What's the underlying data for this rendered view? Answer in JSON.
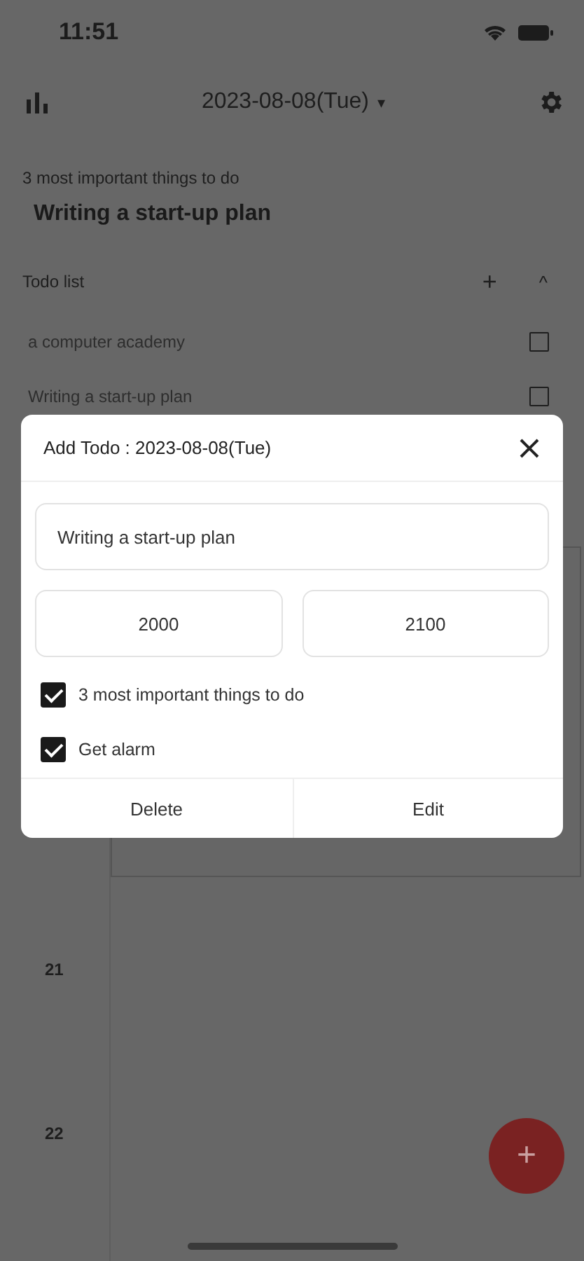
{
  "status_bar": {
    "time": "11:51"
  },
  "header": {
    "date": "2023-08-08(Tue)",
    "dropdown_glyph": "▾"
  },
  "important": {
    "label": "3 most important things to do",
    "items": [
      "Writing a start-up plan"
    ]
  },
  "todo_list": {
    "title": "Todo list",
    "add_glyph": "+",
    "collapse_glyph": "^",
    "items": [
      {
        "text": "a computer academy",
        "checked": false
      },
      {
        "text": "Writing a start-up plan",
        "checked": false
      }
    ]
  },
  "timeline": {
    "hours": [
      "21",
      "22"
    ]
  },
  "dialog": {
    "title": "Add Todo : 2023-08-08(Tue)",
    "value": "Writing a start-up plan",
    "start_time": "2000",
    "end_time": "2100",
    "options": [
      {
        "label": "3 most important things to do",
        "checked": true
      },
      {
        "label": "Get alarm",
        "checked": true
      }
    ],
    "buttons": [
      "Delete",
      "Edit"
    ]
  },
  "fab": {
    "glyph": "+"
  }
}
